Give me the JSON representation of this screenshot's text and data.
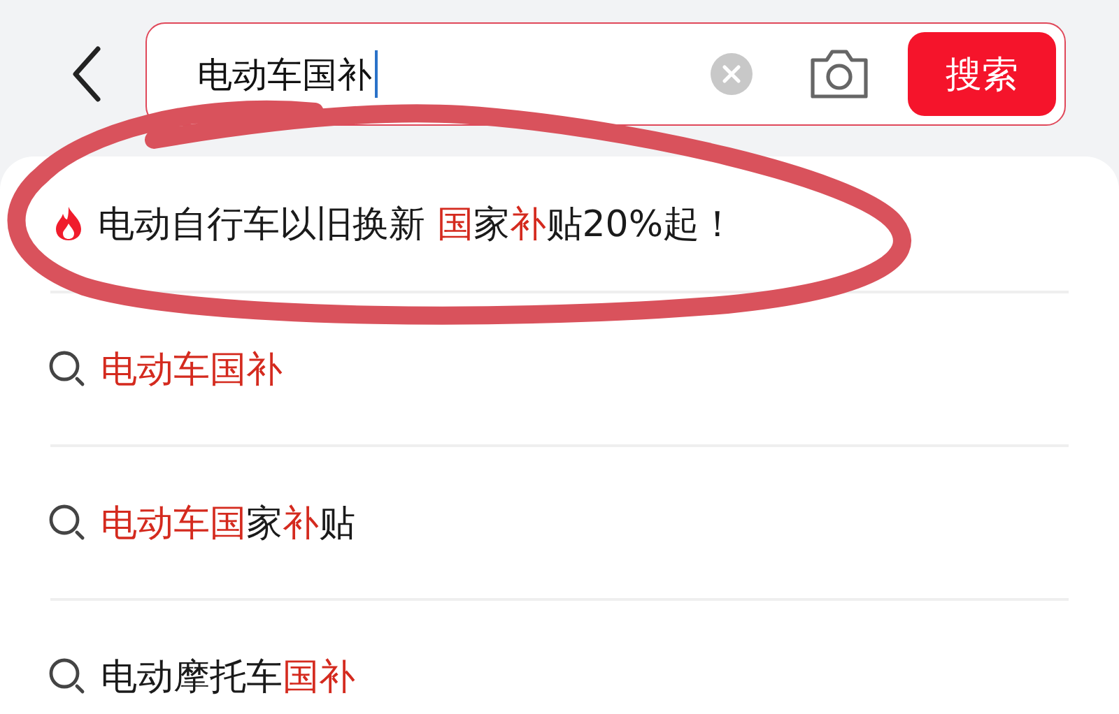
{
  "search": {
    "value": "电动车国补",
    "button": "搜索"
  },
  "suggestions": [
    {
      "kind": "hot",
      "segments": [
        {
          "text": "电动自行车以旧换新 ",
          "highlight": false
        },
        {
          "text": "国",
          "highlight": true
        },
        {
          "text": "家",
          "highlight": false
        },
        {
          "text": "补",
          "highlight": true
        },
        {
          "text": "贴20%起！",
          "highlight": false
        }
      ]
    },
    {
      "kind": "search",
      "segments": [
        {
          "text": "电动车国补",
          "highlight": true
        }
      ]
    },
    {
      "kind": "search",
      "segments": [
        {
          "text": "电动车国",
          "highlight": true
        },
        {
          "text": "家",
          "highlight": false
        },
        {
          "text": "补",
          "highlight": true
        },
        {
          "text": "贴",
          "highlight": false
        }
      ]
    },
    {
      "kind": "search",
      "segments": [
        {
          "text": "电动摩托车",
          "highlight": false
        },
        {
          "text": "国补",
          "highlight": true
        }
      ]
    }
  ]
}
